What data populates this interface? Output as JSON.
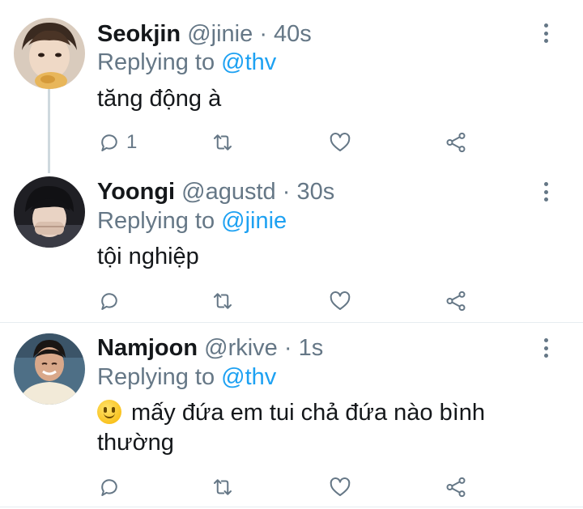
{
  "colors": {
    "text": "#14171a",
    "secondary": "#657786",
    "link": "#1da1f2",
    "divider": "#e6ecf0"
  },
  "tweets": [
    {
      "name": "Seokjin",
      "handle": "@jinie",
      "dot": "·",
      "time": "40s",
      "replying_prefix": "Replying to ",
      "replying_to": "@thv",
      "text": "tăng động à",
      "reply_count": "1",
      "avatar": "avatar-seokjin"
    },
    {
      "name": "Yoongi",
      "handle": "@agustd",
      "dot": "·",
      "time": "30s",
      "replying_prefix": "Replying to ",
      "replying_to": "@jinie",
      "text": "tội nghiệp",
      "reply_count": "",
      "avatar": "avatar-yoongi"
    },
    {
      "name": "Namjoon",
      "handle": "@rkive",
      "dot": "·",
      "time": "1s",
      "replying_prefix": "Replying to ",
      "replying_to": "@thv",
      "emoji": "slightly-smiling-face-emoji",
      "text": "mấy đứa em tui chả đứa nào bình thường",
      "reply_count": "",
      "avatar": "avatar-namjoon"
    }
  ],
  "icons": {
    "reply": "reply-icon",
    "retweet": "retweet-icon",
    "like": "heart-icon",
    "share": "share-icon",
    "more": "more-vertical-icon"
  }
}
